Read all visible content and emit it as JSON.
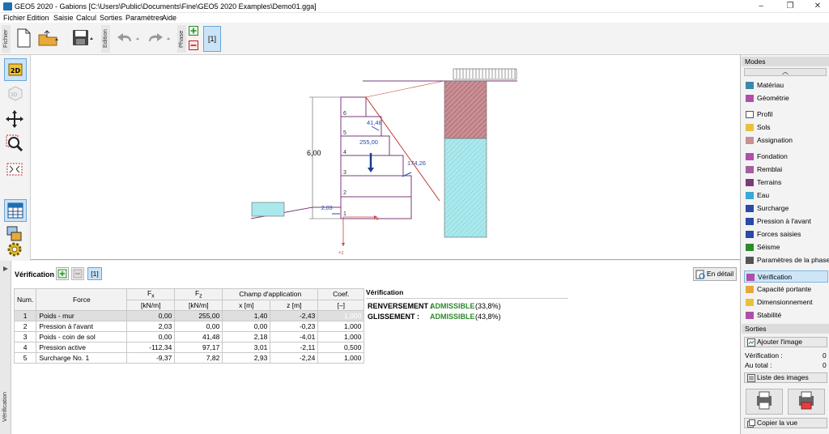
{
  "window": {
    "title": "GEO5 2020 - Gabions [C:\\Users\\Public\\Documents\\Fine\\GEO5 2020 Examples\\Demo01.gga]",
    "min": "–",
    "max": "❐",
    "close": "✕"
  },
  "menu": [
    "Fichier",
    "Edition",
    "Saisie",
    "Calcul",
    "Sorties",
    "Paramètres",
    "Aide"
  ],
  "toolbar": {
    "group_file": "Fichier",
    "group_edit": "Edition",
    "group_phase": "Phase",
    "phase_label": "[1]"
  },
  "canvas": {
    "height_label": "6,00",
    "layer_numbers": [
      "1",
      "2",
      "3",
      "4",
      "5",
      "6"
    ],
    "force_labels": {
      "weight": "255,00",
      "side1": "41,48",
      "side2": "174,26",
      "front": "2,03"
    },
    "axis_x": "+x",
    "axis_z": "+z"
  },
  "verification": {
    "title": "Vérification :",
    "phase_btn": "[1]",
    "detail_btn": "En détail",
    "side_tab": "Vérification",
    "table": {
      "headers": [
        "Num.",
        "Force",
        "Fx",
        "Fz",
        "Champ d'application",
        "Coef."
      ],
      "units": [
        "[kN/m]",
        "[kN/m]",
        "x [m]",
        "z [m]",
        "[–]"
      ],
      "rows": [
        [
          "1",
          "Poids - mur",
          "0,00",
          "255,00",
          "1,40",
          "-2,43",
          "1,000"
        ],
        [
          "2",
          "Pression à l'avant",
          "2,03",
          "0,00",
          "0,00",
          "-0,23",
          "1,000"
        ],
        [
          "3",
          "Poids - coin de sol",
          "0,00",
          "41,48",
          "2,18",
          "-4,01",
          "1,000"
        ],
        [
          "4",
          "Pression active",
          "-112,34",
          "97,17",
          "3,01",
          "-2,11",
          "0,500"
        ],
        [
          "5",
          "Surcharge No. 1",
          "-9,37",
          "7,82",
          "2,93",
          "-2,24",
          "1,000"
        ]
      ]
    },
    "result": {
      "title": "Vérification",
      "overturning_label": "RENVERSEMENT :",
      "overturning_value": "ADMISSIBLE",
      "overturning_pct": "(33,8%)",
      "sliding_label": "GLISSEMENT :",
      "sliding_value": "ADMISSIBLE",
      "sliding_pct": "(43,8%)"
    }
  },
  "modes": {
    "title": "Modes",
    "items": [
      "Matériau",
      "Géométrie",
      "Profil",
      "Sols",
      "Assignation",
      "Fondation",
      "Remblai",
      "Terrains",
      "Eau",
      "Surcharge",
      "Pression à l'avant",
      "Forces saisies",
      "Séisme",
      "Paramètres de la phase",
      "Vérification",
      "Capacité portante",
      "Dimensionnement",
      "Stabilité"
    ]
  },
  "outputs": {
    "title": "Sorties",
    "add_image": "Ajouter l'image",
    "verif_label": "Vérification :",
    "verif_count": "0",
    "total_label": "Au total :",
    "total_count": "0",
    "image_list": "Liste des images",
    "copy_view": "Copier la vue"
  },
  "colors": {
    "accent": "#1f6fb3",
    "soil_red": "#c98f95",
    "water": "#a9e8ec",
    "wall": "#7a3b7a"
  }
}
